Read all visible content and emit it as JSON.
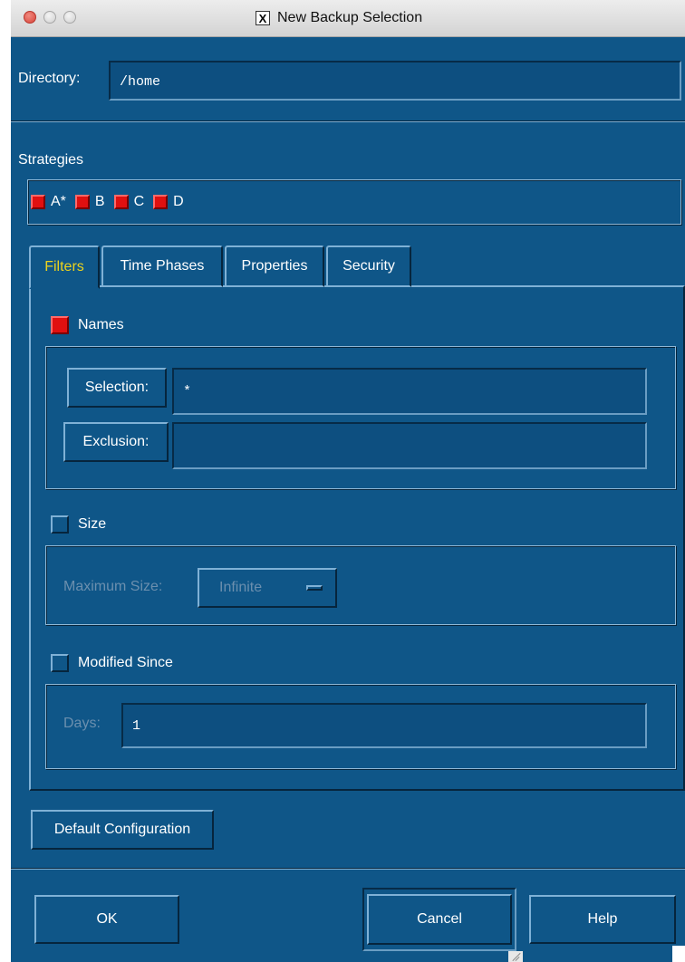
{
  "window": {
    "title": "New Backup Selection"
  },
  "directory": {
    "label": "Directory:",
    "value": "/home"
  },
  "strategies": {
    "label": "Strategies",
    "items": [
      {
        "label": "A*",
        "checked": true
      },
      {
        "label": "B",
        "checked": true
      },
      {
        "label": "C",
        "checked": true
      },
      {
        "label": "D",
        "checked": true
      }
    ]
  },
  "tabs": [
    {
      "label": "Filters",
      "active": true
    },
    {
      "label": "Time Phases",
      "active": false
    },
    {
      "label": "Properties",
      "active": false
    },
    {
      "label": "Security",
      "active": false
    }
  ],
  "filters": {
    "names": {
      "label": "Names",
      "checked": true,
      "selection_label": "Selection:",
      "selection_value": "*",
      "exclusion_label": "Exclusion:",
      "exclusion_value": ""
    },
    "size": {
      "label": "Size",
      "checked": false,
      "max_size_label": "Maximum Size:",
      "max_size_value": "Infinite"
    },
    "modified_since": {
      "label": "Modified Since",
      "checked": false,
      "days_label": "Days:",
      "days_value": "1"
    }
  },
  "buttons": {
    "default_config": "Default Configuration",
    "ok": "OK",
    "cancel": "Cancel",
    "help": "Help"
  },
  "colors": {
    "background": "#0f5688",
    "checked": "#e01010",
    "active_tab_text": "#ecd21c"
  }
}
